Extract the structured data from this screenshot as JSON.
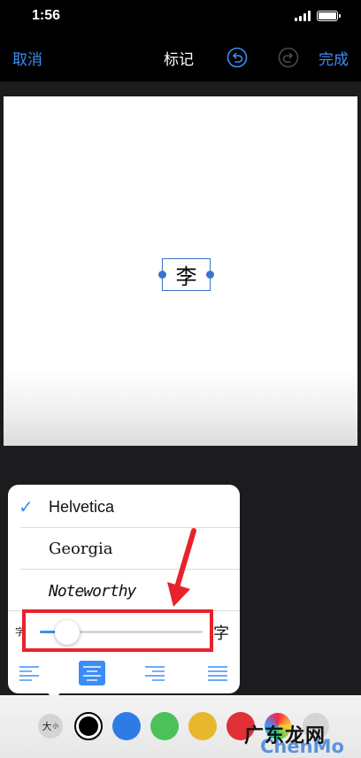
{
  "status_bar": {
    "time": "1:56"
  },
  "nav": {
    "cancel_label": "取消",
    "title": "标记",
    "done_label": "完成"
  },
  "canvas": {
    "text_box_content": "李"
  },
  "font_menu": {
    "fonts": [
      {
        "label": "Helvetica",
        "selected": true
      },
      {
        "label": "Georgia",
        "selected": false
      },
      {
        "label": "Noteworthy",
        "selected": false
      }
    ],
    "size_slider": {
      "small_label": "字",
      "large_label": "字",
      "value_fraction": 0.17
    },
    "alignment": {
      "options": [
        "left",
        "center",
        "right",
        "justify"
      ],
      "selected": "center"
    }
  },
  "toolbar": {
    "size_button_label": "大",
    "size_button_sub": "小",
    "colors": [
      {
        "name": "black",
        "hex": "#000000",
        "selected": true
      },
      {
        "name": "blue",
        "hex": "#2f7be6"
      },
      {
        "name": "green",
        "hex": "#4cc15a"
      },
      {
        "name": "yellow",
        "hex": "#e8b82c"
      },
      {
        "name": "red",
        "hex": "#e02f35"
      }
    ]
  },
  "watermark": {
    "chinese": "广东龙网",
    "latin": "ChenMo"
  },
  "accent_color": "#3b8df5",
  "highlight_color": "#e8222b"
}
